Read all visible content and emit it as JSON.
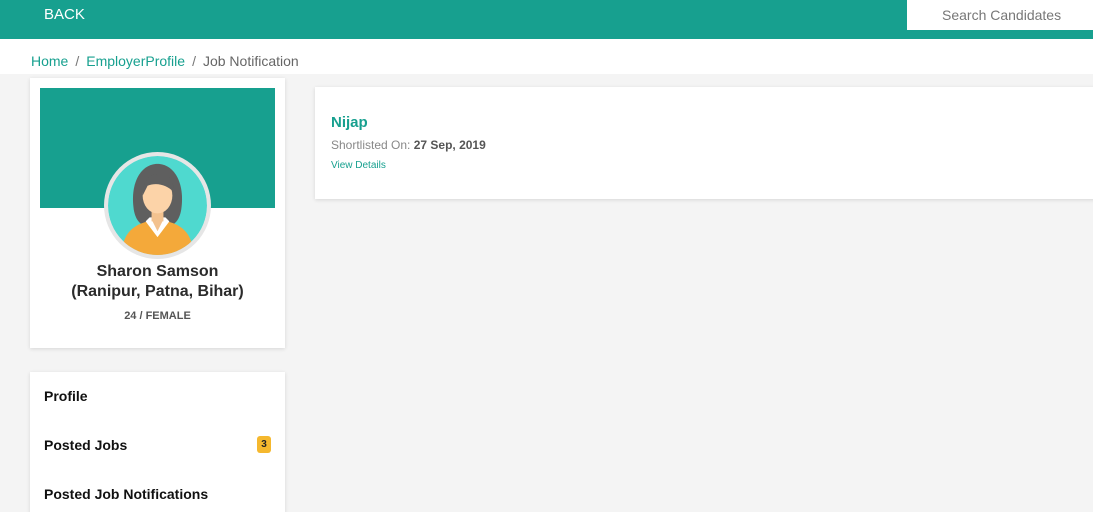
{
  "header": {
    "back_label": "BACK",
    "search_placeholder": "Search Candidates"
  },
  "breadcrumb": {
    "home": "Home",
    "separator": "/",
    "employer_profile": "EmployerProfile",
    "current": "Job Notification"
  },
  "profile": {
    "name": "Sharon Samson",
    "location": "(Ranipur, Patna, Bihar)",
    "age_gender": "24 / FEMALE",
    "avatar_icon": "female-avatar-icon"
  },
  "menu": {
    "items": [
      {
        "label": "Profile",
        "badge": null
      },
      {
        "label": "Posted Jobs",
        "badge": "3"
      },
      {
        "label": "Posted Job Notifications",
        "badge": null
      }
    ]
  },
  "notification": {
    "name": "Nijap",
    "shortlisted_label": "Shortlisted On:",
    "shortlisted_date": "27 Sep, 2019",
    "view_details": "View Details"
  },
  "colors": {
    "accent": "#17a08f",
    "badge": "#f5b82e",
    "background": "#f4f4f4"
  }
}
